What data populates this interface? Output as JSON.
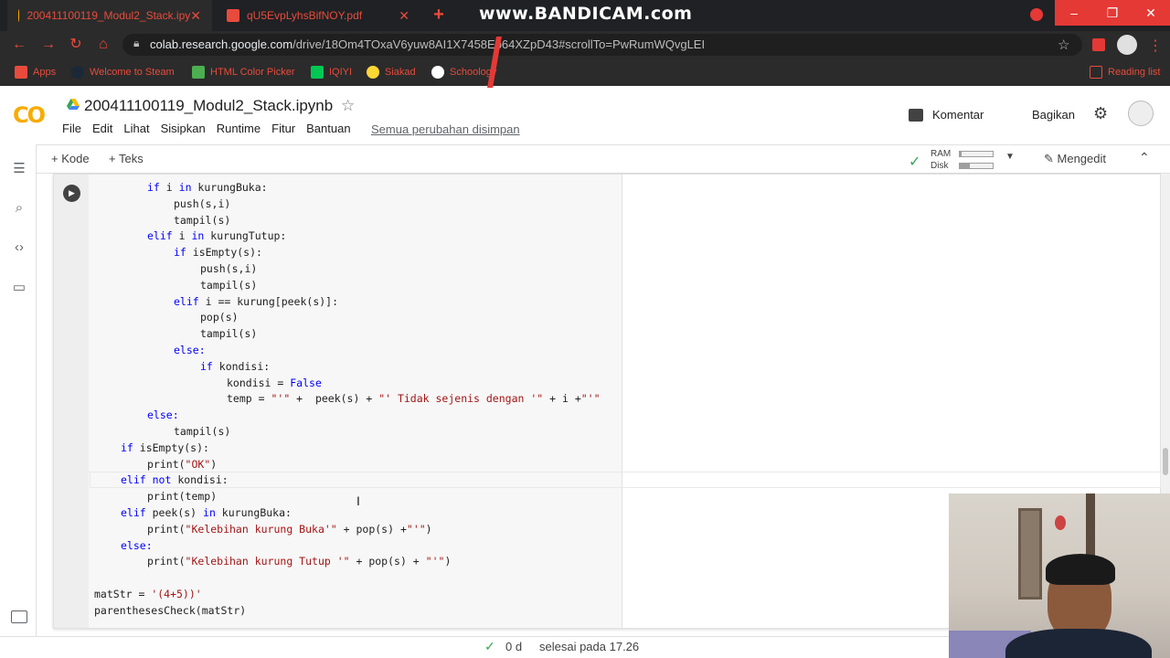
{
  "browser": {
    "tabs": [
      {
        "title": "200411100119_Modul2_Stack.ipy",
        "active": true
      },
      {
        "title": "qU5EvpLyhsBifNOY.pdf",
        "active": false
      }
    ],
    "recorder_banner": "www.BANDICAM.com",
    "url_host": "colab.research.google.com",
    "url_path": "/drive/18Om4TOxaV6yuw8AI1X7458Eb64XZpD43#scrollTo=PwRumWQvgLEI",
    "bookmarks": [
      {
        "label": "Apps",
        "icon": "apps-grid-icon"
      },
      {
        "label": "Welcome to Steam",
        "icon": "steam-icon"
      },
      {
        "label": "HTML Color Picker",
        "icon": "w3schools-icon"
      },
      {
        "label": "IQIYI",
        "icon": "iqiyi-icon"
      },
      {
        "label": "Siakad",
        "icon": "siakad-icon"
      },
      {
        "label": "Schoology",
        "icon": "schoology-icon"
      },
      {
        "label": "Reading list",
        "icon": "reading-list-icon"
      }
    ]
  },
  "colab": {
    "logo": "CO",
    "notebook_title": "200411100119_Modul2_Stack.ipynb",
    "menu": [
      "File",
      "Edit",
      "Lihat",
      "Sisipkan",
      "Runtime",
      "Fitur",
      "Bantuan"
    ],
    "saved_status": "Semua perubahan disimpan",
    "comment_label": "Komentar",
    "share_label": "Bagikan",
    "toolbar": {
      "add_code": "+ Kode",
      "add_text": "+ Teks",
      "ram_label": "RAM",
      "disk_label": "Disk",
      "ram_usage_fraction": 0.05,
      "disk_usage_fraction": 0.3,
      "edit_mode": "Mengedit"
    }
  },
  "code_lines": [
    {
      "indent": 2,
      "parts": [
        {
          "t": "if ",
          "c": "kw"
        },
        {
          "t": "i ",
          "c": ""
        },
        {
          "t": "in ",
          "c": "kw"
        },
        {
          "t": "kurungBuka:",
          "c": ""
        }
      ]
    },
    {
      "indent": 3,
      "parts": [
        {
          "t": "push(s,i)",
          "c": ""
        }
      ]
    },
    {
      "indent": 3,
      "parts": [
        {
          "t": "tampil(s)",
          "c": ""
        }
      ]
    },
    {
      "indent": 2,
      "parts": [
        {
          "t": "elif ",
          "c": "kw"
        },
        {
          "t": "i ",
          "c": ""
        },
        {
          "t": "in ",
          "c": "kw"
        },
        {
          "t": "kurungTutup:",
          "c": ""
        }
      ]
    },
    {
      "indent": 3,
      "parts": [
        {
          "t": "if ",
          "c": "kw"
        },
        {
          "t": "isEmpty(s):",
          "c": ""
        }
      ]
    },
    {
      "indent": 4,
      "parts": [
        {
          "t": "push(s,i)",
          "c": ""
        }
      ]
    },
    {
      "indent": 4,
      "parts": [
        {
          "t": "tampil(s)",
          "c": ""
        }
      ]
    },
    {
      "indent": 3,
      "parts": [
        {
          "t": "elif ",
          "c": "kw"
        },
        {
          "t": "i == kurung[peek(s)]:",
          "c": ""
        }
      ]
    },
    {
      "indent": 4,
      "parts": [
        {
          "t": "pop(s)",
          "c": ""
        }
      ]
    },
    {
      "indent": 4,
      "parts": [
        {
          "t": "tampil(s)",
          "c": ""
        }
      ]
    },
    {
      "indent": 3,
      "parts": [
        {
          "t": "else:",
          "c": "kw"
        }
      ]
    },
    {
      "indent": 4,
      "parts": [
        {
          "t": "if ",
          "c": "kw"
        },
        {
          "t": "kondisi:",
          "c": ""
        }
      ]
    },
    {
      "indent": 5,
      "parts": [
        {
          "t": "kondisi = ",
          "c": ""
        },
        {
          "t": "False",
          "c": "kw"
        }
      ]
    },
    {
      "indent": 5,
      "parts": [
        {
          "t": "temp = ",
          "c": ""
        },
        {
          "t": "\"'\"",
          "c": "str"
        },
        {
          "t": " +  peek(s) + ",
          "c": ""
        },
        {
          "t": "\"' Tidak sejenis dengan '\"",
          "c": "str"
        },
        {
          "t": " + i +",
          "c": ""
        },
        {
          "t": "\"'\"",
          "c": "str"
        }
      ]
    },
    {
      "indent": 2,
      "parts": [
        {
          "t": "else:",
          "c": "kw"
        }
      ]
    },
    {
      "indent": 3,
      "parts": [
        {
          "t": "tampil(s)",
          "c": ""
        }
      ]
    },
    {
      "indent": 1,
      "parts": [
        {
          "t": "if ",
          "c": "kw"
        },
        {
          "t": "isEmpty(s):",
          "c": ""
        }
      ]
    },
    {
      "indent": 2,
      "parts": [
        {
          "t": "print(",
          "c": ""
        },
        {
          "t": "\"OK\"",
          "c": "str"
        },
        {
          "t": ")",
          "c": ""
        }
      ]
    },
    {
      "indent": 1,
      "parts": [
        {
          "t": "elif not ",
          "c": "kw"
        },
        {
          "t": "kondisi:",
          "c": ""
        }
      ]
    },
    {
      "indent": 2,
      "parts": [
        {
          "t": "print(temp)",
          "c": ""
        }
      ]
    },
    {
      "indent": 1,
      "parts": [
        {
          "t": "elif ",
          "c": "kw"
        },
        {
          "t": "peek(s) ",
          "c": ""
        },
        {
          "t": "in ",
          "c": "kw"
        },
        {
          "t": "kurungBuka:",
          "c": ""
        }
      ]
    },
    {
      "indent": 2,
      "parts": [
        {
          "t": "print(",
          "c": ""
        },
        {
          "t": "\"Kelebihan kurung Buka'\"",
          "c": "str"
        },
        {
          "t": " + pop(s) +",
          "c": ""
        },
        {
          "t": "\"'\"",
          "c": "str"
        },
        {
          "t": ")",
          "c": ""
        }
      ]
    },
    {
      "indent": 1,
      "parts": [
        {
          "t": "else:",
          "c": "kw"
        }
      ]
    },
    {
      "indent": 2,
      "parts": [
        {
          "t": "print(",
          "c": ""
        },
        {
          "t": "\"Kelebihan kurung Tutup '\"",
          "c": "str"
        },
        {
          "t": " + pop(s) + ",
          "c": ""
        },
        {
          "t": "\"'\"",
          "c": "str"
        },
        {
          "t": ")",
          "c": ""
        }
      ]
    },
    {
      "indent": 0,
      "parts": [
        {
          "t": "",
          "c": ""
        }
      ]
    },
    {
      "indent": 0,
      "parts": [
        {
          "t": "matStr = ",
          "c": ""
        },
        {
          "t": "'(4+5))'",
          "c": "str"
        }
      ]
    },
    {
      "indent": 0,
      "parts": [
        {
          "t": "parenthesesCheck(matStr)",
          "c": ""
        }
      ]
    }
  ],
  "status": {
    "elapsed": "0 d",
    "finished": "selesai pada 17.26"
  },
  "colors": {
    "keyword": "#0000ff",
    "string": "#a31515",
    "chrome_accent": "#e84b3c",
    "colab_orange": "#f9ab00"
  }
}
